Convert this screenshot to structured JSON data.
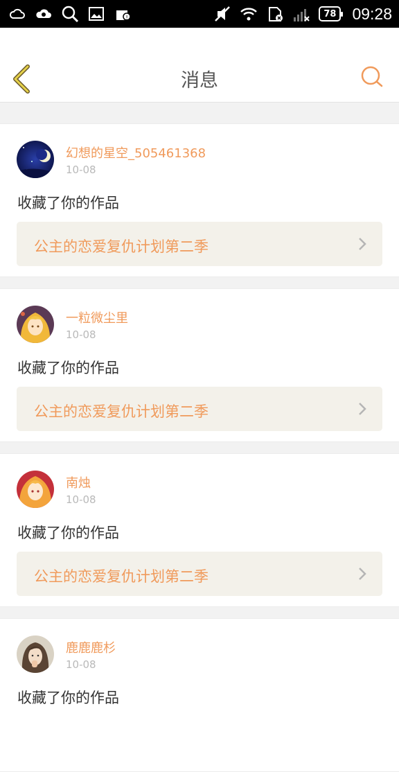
{
  "status_bar": {
    "time": "09:28",
    "battery": "78",
    "icons_left": [
      "cloud-icon",
      "cloud-sync-icon",
      "search-icon",
      "image-icon",
      "store-icon"
    ],
    "icons_right": [
      "mute-icon",
      "wifi-icon",
      "sim-icon",
      "signal-icon",
      "battery-icon"
    ]
  },
  "header": {
    "title": "消息",
    "back_icon": "back-chevron-icon",
    "search_icon": "search-icon",
    "accent_color": "#f09a5b"
  },
  "messages": [
    {
      "username": "幻想的星空_505461368",
      "date": "10-08",
      "action": "收藏了你的作品",
      "work_title": "公主的恋爱复仇计划第二季",
      "avatar": "night-moon-avatar"
    },
    {
      "username": "一粒微尘里",
      "date": "10-08",
      "action": "收藏了你的作品",
      "work_title": "公主的恋爱复仇计划第二季",
      "avatar": "anime-girl-blonde-avatar"
    },
    {
      "username": "南烛",
      "date": "10-08",
      "action": "收藏了你的作品",
      "work_title": "公主的恋爱复仇计划第二季",
      "avatar": "anime-girl-orange-avatar"
    },
    {
      "username": "鹿鹿鹿杉",
      "date": "10-08",
      "action": "收藏了你的作品",
      "work_title": "",
      "avatar": "photo-girl-avatar"
    }
  ]
}
